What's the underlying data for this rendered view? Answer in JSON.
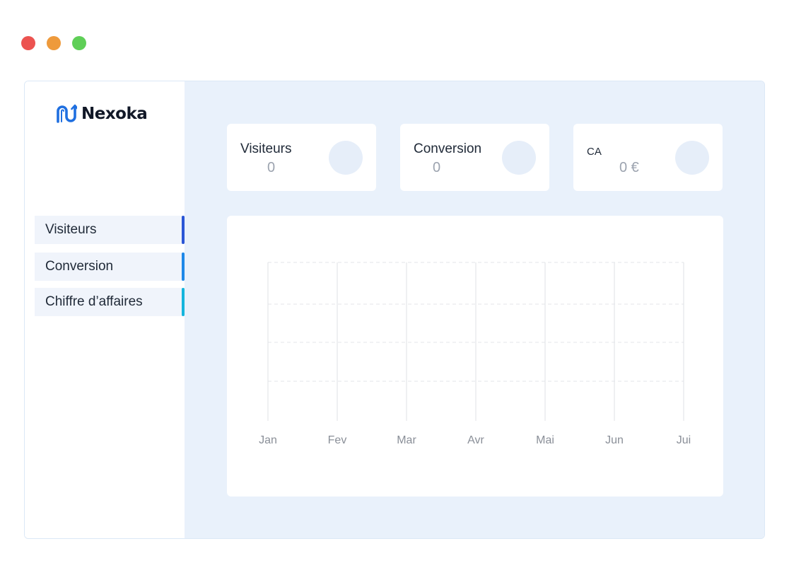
{
  "window_controls": [
    "close",
    "minimize",
    "maximize"
  ],
  "brand": {
    "name": "Nexoka",
    "icon": "nexoka-logo-icon",
    "accent": "#1f6fe0"
  },
  "sidebar": {
    "items": [
      {
        "label": "Visiteurs",
        "color": "#2b56d6"
      },
      {
        "label": "Conversion",
        "color": "#1e88e8"
      },
      {
        "label": "Chiffre d’affaires",
        "color": "#15b5dd"
      }
    ]
  },
  "stats": [
    {
      "label": "Visiteurs",
      "value": "0"
    },
    {
      "label": "Conversion",
      "value": "0"
    },
    {
      "label": "CA",
      "value": "0 €"
    }
  ],
  "chart_data": {
    "type": "line",
    "categories": [
      "Jan",
      "Fev",
      "Mar",
      "Avr",
      "Mai",
      "Jun",
      "Jui"
    ],
    "series": [],
    "grid": true
  }
}
